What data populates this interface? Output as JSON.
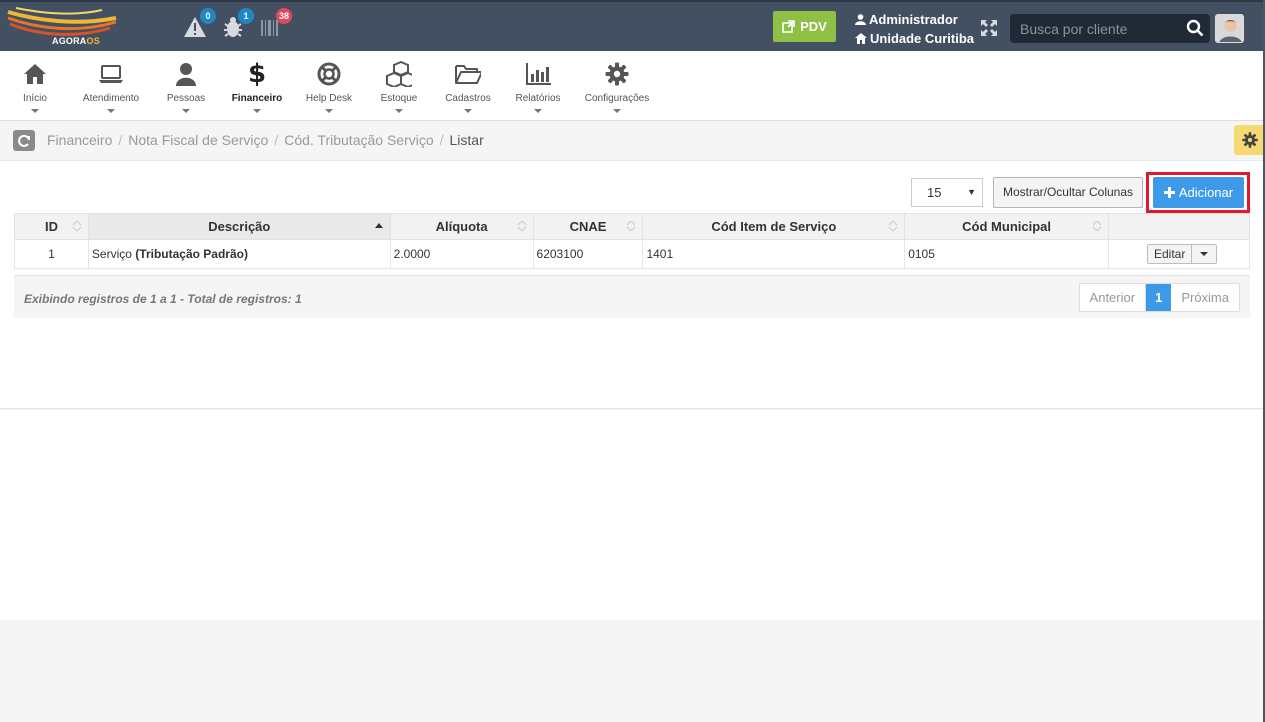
{
  "topbar": {
    "logo_text_a": "AGORA",
    "logo_text_b": "OS",
    "alerts_count": "0",
    "tasks_count": "1",
    "barcode_count": "38",
    "pdv_label": "PDV",
    "user_name": "Administrador",
    "unit_name": "Unidade Curitiba",
    "search_placeholder": "Busca por cliente"
  },
  "nav": {
    "items": [
      {
        "label": "Início",
        "icon": "home-icon"
      },
      {
        "label": "Atendimento",
        "icon": "laptop-icon"
      },
      {
        "label": "Pessoas",
        "icon": "user-icon"
      },
      {
        "label": "Financeiro",
        "icon": "dollar-icon"
      },
      {
        "label": "Help Desk",
        "icon": "lifebuoy-icon"
      },
      {
        "label": "Estoque",
        "icon": "cubes-icon"
      },
      {
        "label": "Cadastros",
        "icon": "folder-icon"
      },
      {
        "label": "Relatórios",
        "icon": "bar-chart-icon"
      },
      {
        "label": "Configurações",
        "icon": "gear-icon"
      }
    ]
  },
  "breadcrumb": {
    "items": [
      "Financeiro",
      "Nota Fiscal de Serviço",
      "Cód. Tributação Serviço"
    ],
    "separator": "/",
    "current": "Listar"
  },
  "toolbar": {
    "page_size": "15",
    "columns_button": "Mostrar/Ocultar Colunas",
    "add_button": "Adicionar"
  },
  "table": {
    "headers": [
      "ID",
      "Descrição",
      "Alíquota",
      "CNAE",
      "Cód Item de Serviço",
      "Cód Municipal"
    ],
    "rows": [
      {
        "id": "1",
        "descricao_prefix": "Serviço",
        "descricao_bold": "(Tributação Padrão)",
        "aliquota": "2.0000",
        "cnae": "6203100",
        "cod_item": "1401",
        "cod_municipal": "0105",
        "action_label": "Editar"
      }
    ]
  },
  "footer": {
    "info": "Exibindo registros de 1 a 1 - Total de registros: 1",
    "prev": "Anterior",
    "current_page": "1",
    "next": "Próxima"
  },
  "colors": {
    "topbar": "#435062",
    "pdv": "#8dc044",
    "primary": "#3d9ae8",
    "highlight": "#e01a2b",
    "side_gear": "#f6d970"
  }
}
